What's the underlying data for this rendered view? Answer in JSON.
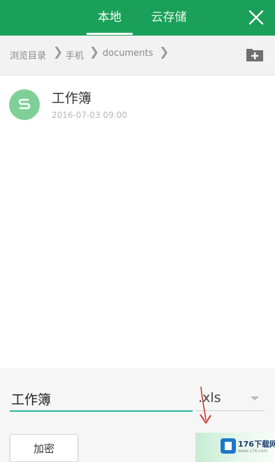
{
  "header": {
    "tabs": [
      {
        "label": "本地",
        "active": true
      },
      {
        "label": "云存储",
        "active": false
      }
    ],
    "close_icon": "close-icon"
  },
  "breadcrumb": {
    "items": [
      "浏览目录",
      "手机",
      "documents"
    ],
    "new_folder_icon": "folder-plus-icon"
  },
  "files": [
    {
      "name": "工作簿",
      "date": "2016-07-03  09:00",
      "icon": "spreadsheet-s-icon"
    }
  ],
  "save_panel": {
    "filename_value": "工作簿",
    "extension": ".xls",
    "encrypt_label": "加密"
  },
  "watermark": {
    "text": "176下载网",
    "url": "www.176.com"
  },
  "colors": {
    "header": "#1aa058",
    "file_icon": "#7fcf98",
    "input_underline": "#2ab2a0",
    "annotation_arrow": "#d23a2a"
  }
}
